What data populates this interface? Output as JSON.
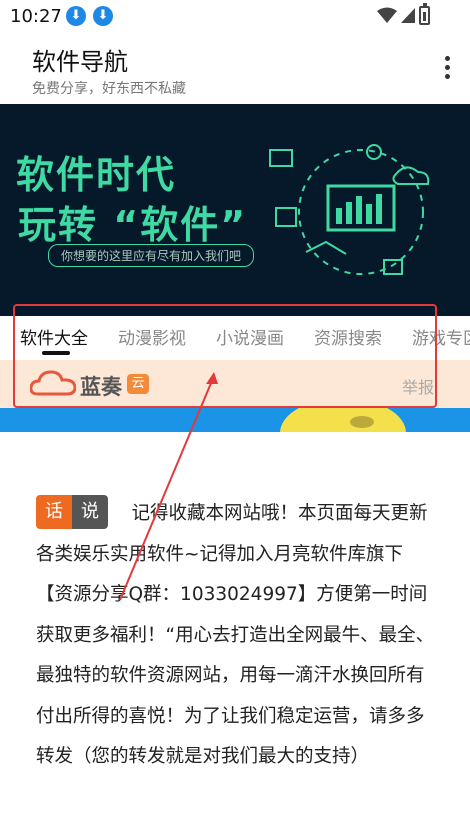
{
  "status": {
    "time": "10:27"
  },
  "app": {
    "title": "软件导航",
    "subtitle": "免费分享，好东西不私藏"
  },
  "banner": {
    "line1": "软件时代",
    "line2": "玩转 “软件”",
    "caption": "你想要的这里应有尽有加入我们吧"
  },
  "tabs": [
    {
      "label": "软件大全",
      "active": true
    },
    {
      "label": "动漫影视"
    },
    {
      "label": "小说漫画"
    },
    {
      "label": "资源搜索"
    },
    {
      "label": "游戏专区"
    }
  ],
  "ad": {
    "brand": "蓝奏",
    "badge": "云",
    "report": "举报"
  },
  "notice": {
    "tag1": "话",
    "tag2": "说",
    "text": "记得收藏本网站哦！本页面每天更新各类娱乐实用软件~记得加入月亮软件库旗下【资源分享Q群：1033024997】方便第一时间获取更多福利！“用心去打造出全网最牛、最全、最独特的软件资源网站，用每一滴汗水换回所有付出所得的喜悦！为了让我们稳定运营，请多多转发（您的转发就是对我们最大的支持）"
  },
  "colors": {
    "accent_green": "#3fd9a3",
    "banner_bg": "#06192a",
    "annotation_red": "#e23a3a",
    "tag_orange": "#ef6a21",
    "ad_bg": "#fde7d6"
  },
  "icons": [
    "download-icon",
    "wifi-icon",
    "signal-icon",
    "battery-icon",
    "more-vert-icon",
    "cloud-logo-icon"
  ]
}
